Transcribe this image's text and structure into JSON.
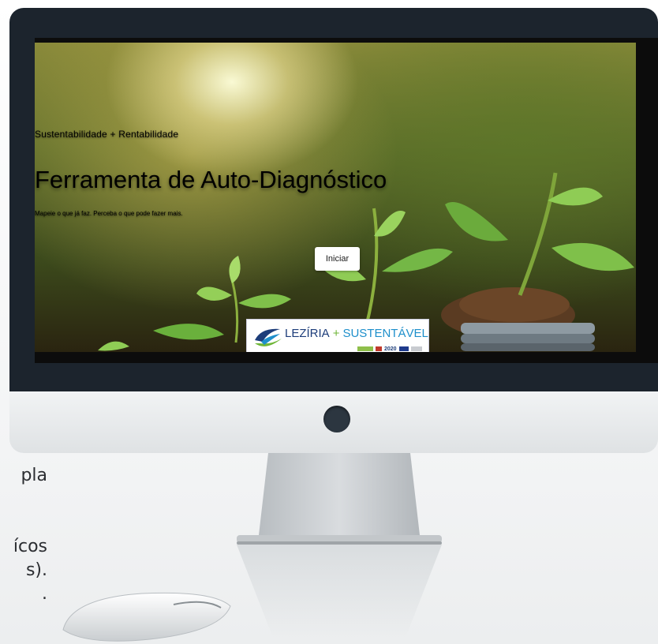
{
  "page": {
    "side_text_fragments": [
      "pla",
      "ícos",
      "s).",
      "."
    ]
  },
  "hero": {
    "tagline": "Sustentabilidade + Rentabilidade",
    "headline": "Ferramenta de Auto-Diagnóstico",
    "subtitle": "Mapeie o que já faz. Perceba o que pode fazer mais.",
    "cta_label": "Iniciar"
  },
  "logo": {
    "brand_part1": "LEZÍRIA",
    "plus": "+",
    "brand_part2": "SUSTENTÁVEL",
    "partner_text": "2020"
  },
  "colors": {
    "bezel": "#1c242d",
    "chin": "#e8eaec",
    "brand_blue": "#1d3d7a",
    "brand_green": "#6fb637",
    "brand_cyan": "#1e8fcb"
  }
}
